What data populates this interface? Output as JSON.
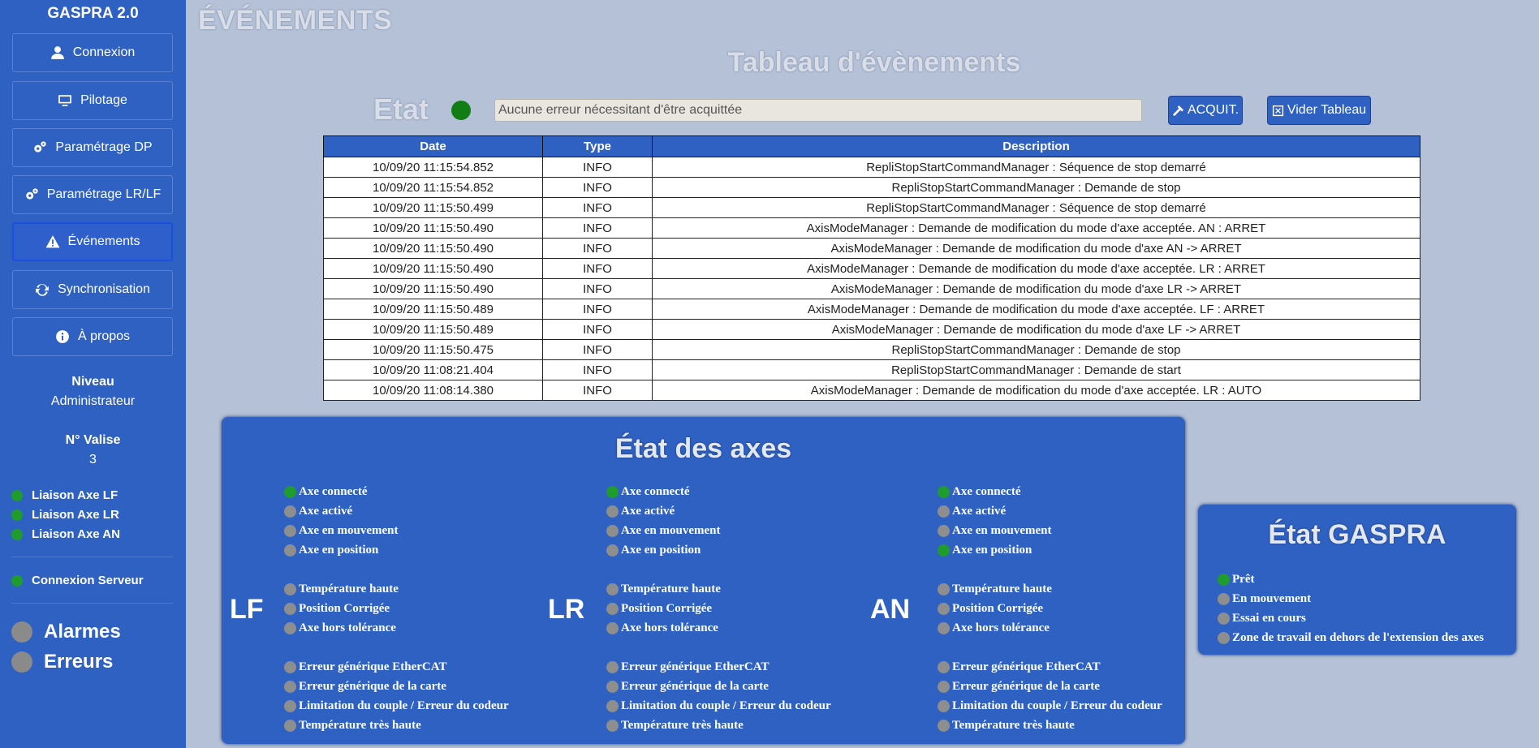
{
  "app": {
    "title": "GASPRA 2.0"
  },
  "nav": {
    "items": [
      {
        "label": "Connexion",
        "icon": "user-icon"
      },
      {
        "label": "Pilotage",
        "icon": "monitor-icon"
      },
      {
        "label": "Paramétrage DP",
        "icon": "gears-icon"
      },
      {
        "label": "Paramétrage LR/LF",
        "icon": "gears-icon"
      },
      {
        "label": "Événements",
        "icon": "warning-icon"
      },
      {
        "label": "Synchronisation",
        "icon": "sync-icon"
      },
      {
        "label": "À propos",
        "icon": "info-icon"
      }
    ]
  },
  "user": {
    "level_label": "Niveau",
    "level_value": "Administrateur",
    "case_label": "N° Valise",
    "case_value": "3"
  },
  "links": [
    {
      "label": "Liaison Axe LF",
      "status": "green"
    },
    {
      "label": "Liaison Axe LR",
      "status": "green"
    },
    {
      "label": "Liaison Axe AN",
      "status": "green"
    }
  ],
  "server": {
    "label": "Connexion Serveur",
    "status": "green"
  },
  "alarms": {
    "alarmes": "Alarmes",
    "erreurs": "Erreurs"
  },
  "main": {
    "page_title": "ÉVÉNEMENTS",
    "table_title": "Tableau d'évènements",
    "etat_label": "Etat",
    "error_message": "Aucune erreur nécessitant d'être acquittée",
    "ack_button": "ACQUIT.",
    "clear_button": "Vider Tableau"
  },
  "table": {
    "headers": [
      "Date",
      "Type",
      "Description"
    ],
    "rows": [
      [
        "10/09/20 11:15:54.852",
        "INFO",
        "RepliStopStartCommandManager : Séquence de stop demarré"
      ],
      [
        "10/09/20 11:15:54.852",
        "INFO",
        "RepliStopStartCommandManager : Demande de stop"
      ],
      [
        "10/09/20 11:15:50.499",
        "INFO",
        "RepliStopStartCommandManager : Séquence de stop demarré"
      ],
      [
        "10/09/20 11:15:50.490",
        "INFO",
        "AxisModeManager : Demande de modification du mode d'axe acceptée. AN : ARRET"
      ],
      [
        "10/09/20 11:15:50.490",
        "INFO",
        "AxisModeManager : Demande de modification du mode d'axe AN -> ARRET"
      ],
      [
        "10/09/20 11:15:50.490",
        "INFO",
        "AxisModeManager : Demande de modification du mode d'axe acceptée. LR : ARRET"
      ],
      [
        "10/09/20 11:15:50.490",
        "INFO",
        "AxisModeManager : Demande de modification du mode d'axe LR -> ARRET"
      ],
      [
        "10/09/20 11:15:50.489",
        "INFO",
        "AxisModeManager : Demande de modification du mode d'axe acceptée. LF : ARRET"
      ],
      [
        "10/09/20 11:15:50.489",
        "INFO",
        "AxisModeManager : Demande de modification du mode d'axe LF -> ARRET"
      ],
      [
        "10/09/20 11:15:50.475",
        "INFO",
        "RepliStopStartCommandManager : Demande de stop"
      ],
      [
        "10/09/20 11:08:21.404",
        "INFO",
        "RepliStopStartCommandManager : Demande de start"
      ],
      [
        "10/09/20 11:08:14.380",
        "INFO",
        "AxisModeManager : Demande de modification du mode d'axe acceptée. LR : AUTO"
      ]
    ]
  },
  "axes": {
    "title": "État des axes",
    "columns": [
      {
        "name": "LF",
        "states": [
          {
            "label": "Axe connecté",
            "status": "green"
          },
          {
            "label": "Axe activé",
            "status": "gray"
          },
          {
            "label": "Axe en mouvement",
            "status": "gray"
          },
          {
            "label": "Axe en position",
            "status": "gray"
          },
          {
            "label": "Température haute",
            "status": "gray"
          },
          {
            "label": "Position Corrigée",
            "status": "gray"
          },
          {
            "label": "Axe hors tolérance",
            "status": "gray"
          },
          {
            "label": "Erreur générique EtherCAT",
            "status": "gray"
          },
          {
            "label": "Erreur générique de la carte",
            "status": "gray"
          },
          {
            "label": "Limitation du couple / Erreur du codeur",
            "status": "gray"
          },
          {
            "label": "Température très haute",
            "status": "gray"
          }
        ]
      },
      {
        "name": "LR",
        "states": [
          {
            "label": "Axe connecté",
            "status": "green"
          },
          {
            "label": "Axe activé",
            "status": "gray"
          },
          {
            "label": "Axe en mouvement",
            "status": "gray"
          },
          {
            "label": "Axe en position",
            "status": "gray"
          },
          {
            "label": "Température haute",
            "status": "gray"
          },
          {
            "label": "Position Corrigée",
            "status": "gray"
          },
          {
            "label": "Axe hors tolérance",
            "status": "gray"
          },
          {
            "label": "Erreur générique EtherCAT",
            "status": "gray"
          },
          {
            "label": "Erreur générique de la carte",
            "status": "gray"
          },
          {
            "label": "Limitation du couple / Erreur du codeur",
            "status": "gray"
          },
          {
            "label": "Température très haute",
            "status": "gray"
          }
        ]
      },
      {
        "name": "AN",
        "states": [
          {
            "label": "Axe connecté",
            "status": "green"
          },
          {
            "label": "Axe activé",
            "status": "gray"
          },
          {
            "label": "Axe en mouvement",
            "status": "gray"
          },
          {
            "label": "Axe en position",
            "status": "green"
          },
          {
            "label": "Température haute",
            "status": "gray"
          },
          {
            "label": "Position Corrigée",
            "status": "gray"
          },
          {
            "label": "Axe hors tolérance",
            "status": "gray"
          },
          {
            "label": "Erreur générique EtherCAT",
            "status": "gray"
          },
          {
            "label": "Erreur générique de la carte",
            "status": "gray"
          },
          {
            "label": "Limitation du couple / Erreur du codeur",
            "status": "gray"
          },
          {
            "label": "Température très haute",
            "status": "gray"
          }
        ]
      }
    ]
  },
  "gaspra": {
    "title": "État GASPRA",
    "states": [
      {
        "label": "Prêt",
        "status": "green"
      },
      {
        "label": "En mouvement",
        "status": "gray"
      },
      {
        "label": "Essai en cours",
        "status": "gray"
      },
      {
        "label": "Zone de travail en dehors de l'extension des axes",
        "status": "gray"
      }
    ]
  },
  "colors": {
    "sidebar": "#2f61c2",
    "background": "#b4c1d7",
    "ok": "#1f9c2d",
    "off": "#8e8e8e"
  }
}
